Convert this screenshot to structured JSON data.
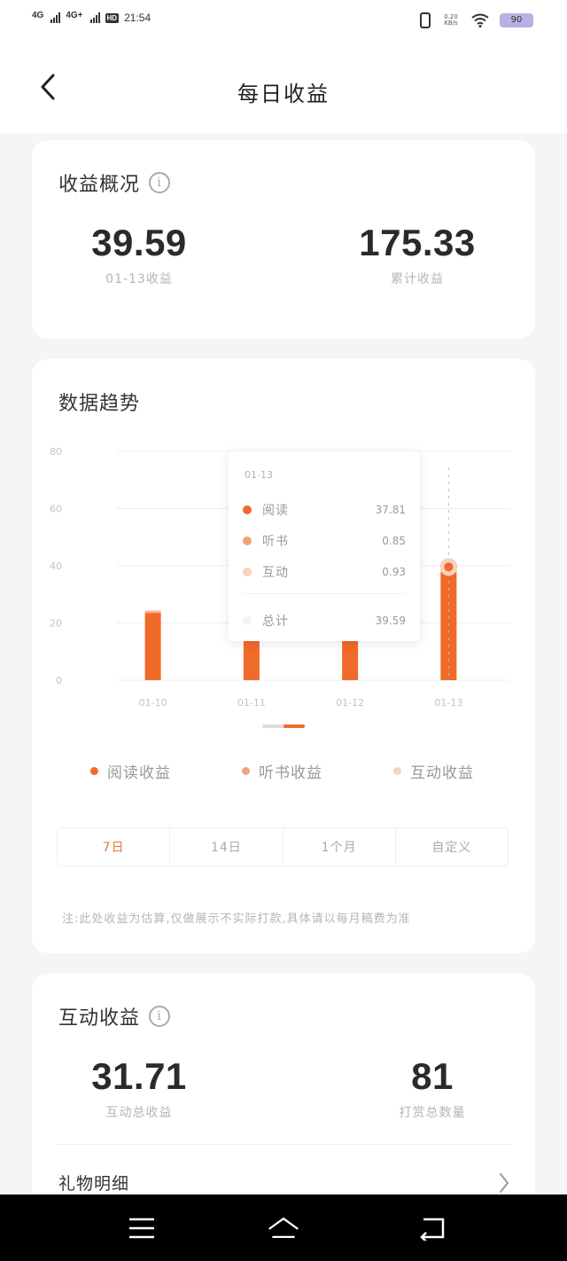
{
  "status_bar": {
    "network1": "4G",
    "network2": "4G+",
    "hd_badge": "HD",
    "time": "21:54",
    "net_speed": "0.20",
    "net_speed_unit": "KB/s",
    "battery": "90"
  },
  "header": {
    "title": "每日收益"
  },
  "overview": {
    "title": "收益概况",
    "daily_value": "39.59",
    "daily_label": "01-13收益",
    "total_value": "175.33",
    "total_label": "累计收益"
  },
  "trend": {
    "title": "数据趋势",
    "legend": [
      "阅读收益",
      "听书收益",
      "互动收益"
    ],
    "tabs": [
      "7日",
      "14日",
      "1个月",
      "自定义"
    ],
    "active_tab": "7日",
    "note": "注:此处收益为估算,仅做展示不实际打款,具体请以每月稿费为准",
    "tooltip": {
      "date": "01-13",
      "rows": [
        {
          "name": "阅读",
          "value": "37.81"
        },
        {
          "name": "听书",
          "value": "0.85"
        },
        {
          "name": "互动",
          "value": "0.93"
        }
      ],
      "total_name": "总计",
      "total_value": "39.59"
    }
  },
  "chart_data": {
    "type": "bar",
    "categories": [
      "01-10",
      "01-11",
      "01-12",
      "01-13"
    ],
    "ylim": [
      0,
      80
    ],
    "yticks": [
      0,
      20,
      40,
      60,
      80
    ],
    "series": [
      {
        "name": "阅读收益",
        "values": [
          23.5,
          22,
          21,
          37.81
        ]
      },
      {
        "name": "听书收益",
        "values": [
          0.5,
          0.5,
          0.5,
          0.85
        ]
      },
      {
        "name": "互动收益",
        "values": [
          0.5,
          0.5,
          0.5,
          0.93
        ]
      }
    ],
    "colors": [
      "#f06a29",
      "#f2a37a",
      "#f8d2bd"
    ],
    "grid": true,
    "legend_position": "bottom"
  },
  "interaction": {
    "title": "互动收益",
    "total_value": "31.71",
    "total_label": "互动总收益",
    "count_value": "81",
    "count_label": "打赏总数量",
    "gift_detail": "礼物明细"
  }
}
